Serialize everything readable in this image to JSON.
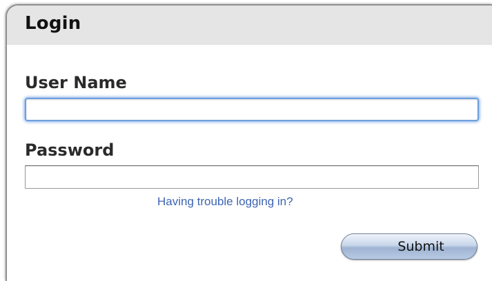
{
  "panel": {
    "title": "Login"
  },
  "form": {
    "username": {
      "label": "User Name",
      "value": "",
      "placeholder": ""
    },
    "password": {
      "label": "Password",
      "value": "",
      "placeholder": ""
    },
    "trouble_link": "Having trouble logging in?",
    "submit_label": "Submit"
  },
  "colors": {
    "header_bg": "#e5e5e5",
    "link": "#3d64b4",
    "focus_ring": "#6e9fdd"
  }
}
